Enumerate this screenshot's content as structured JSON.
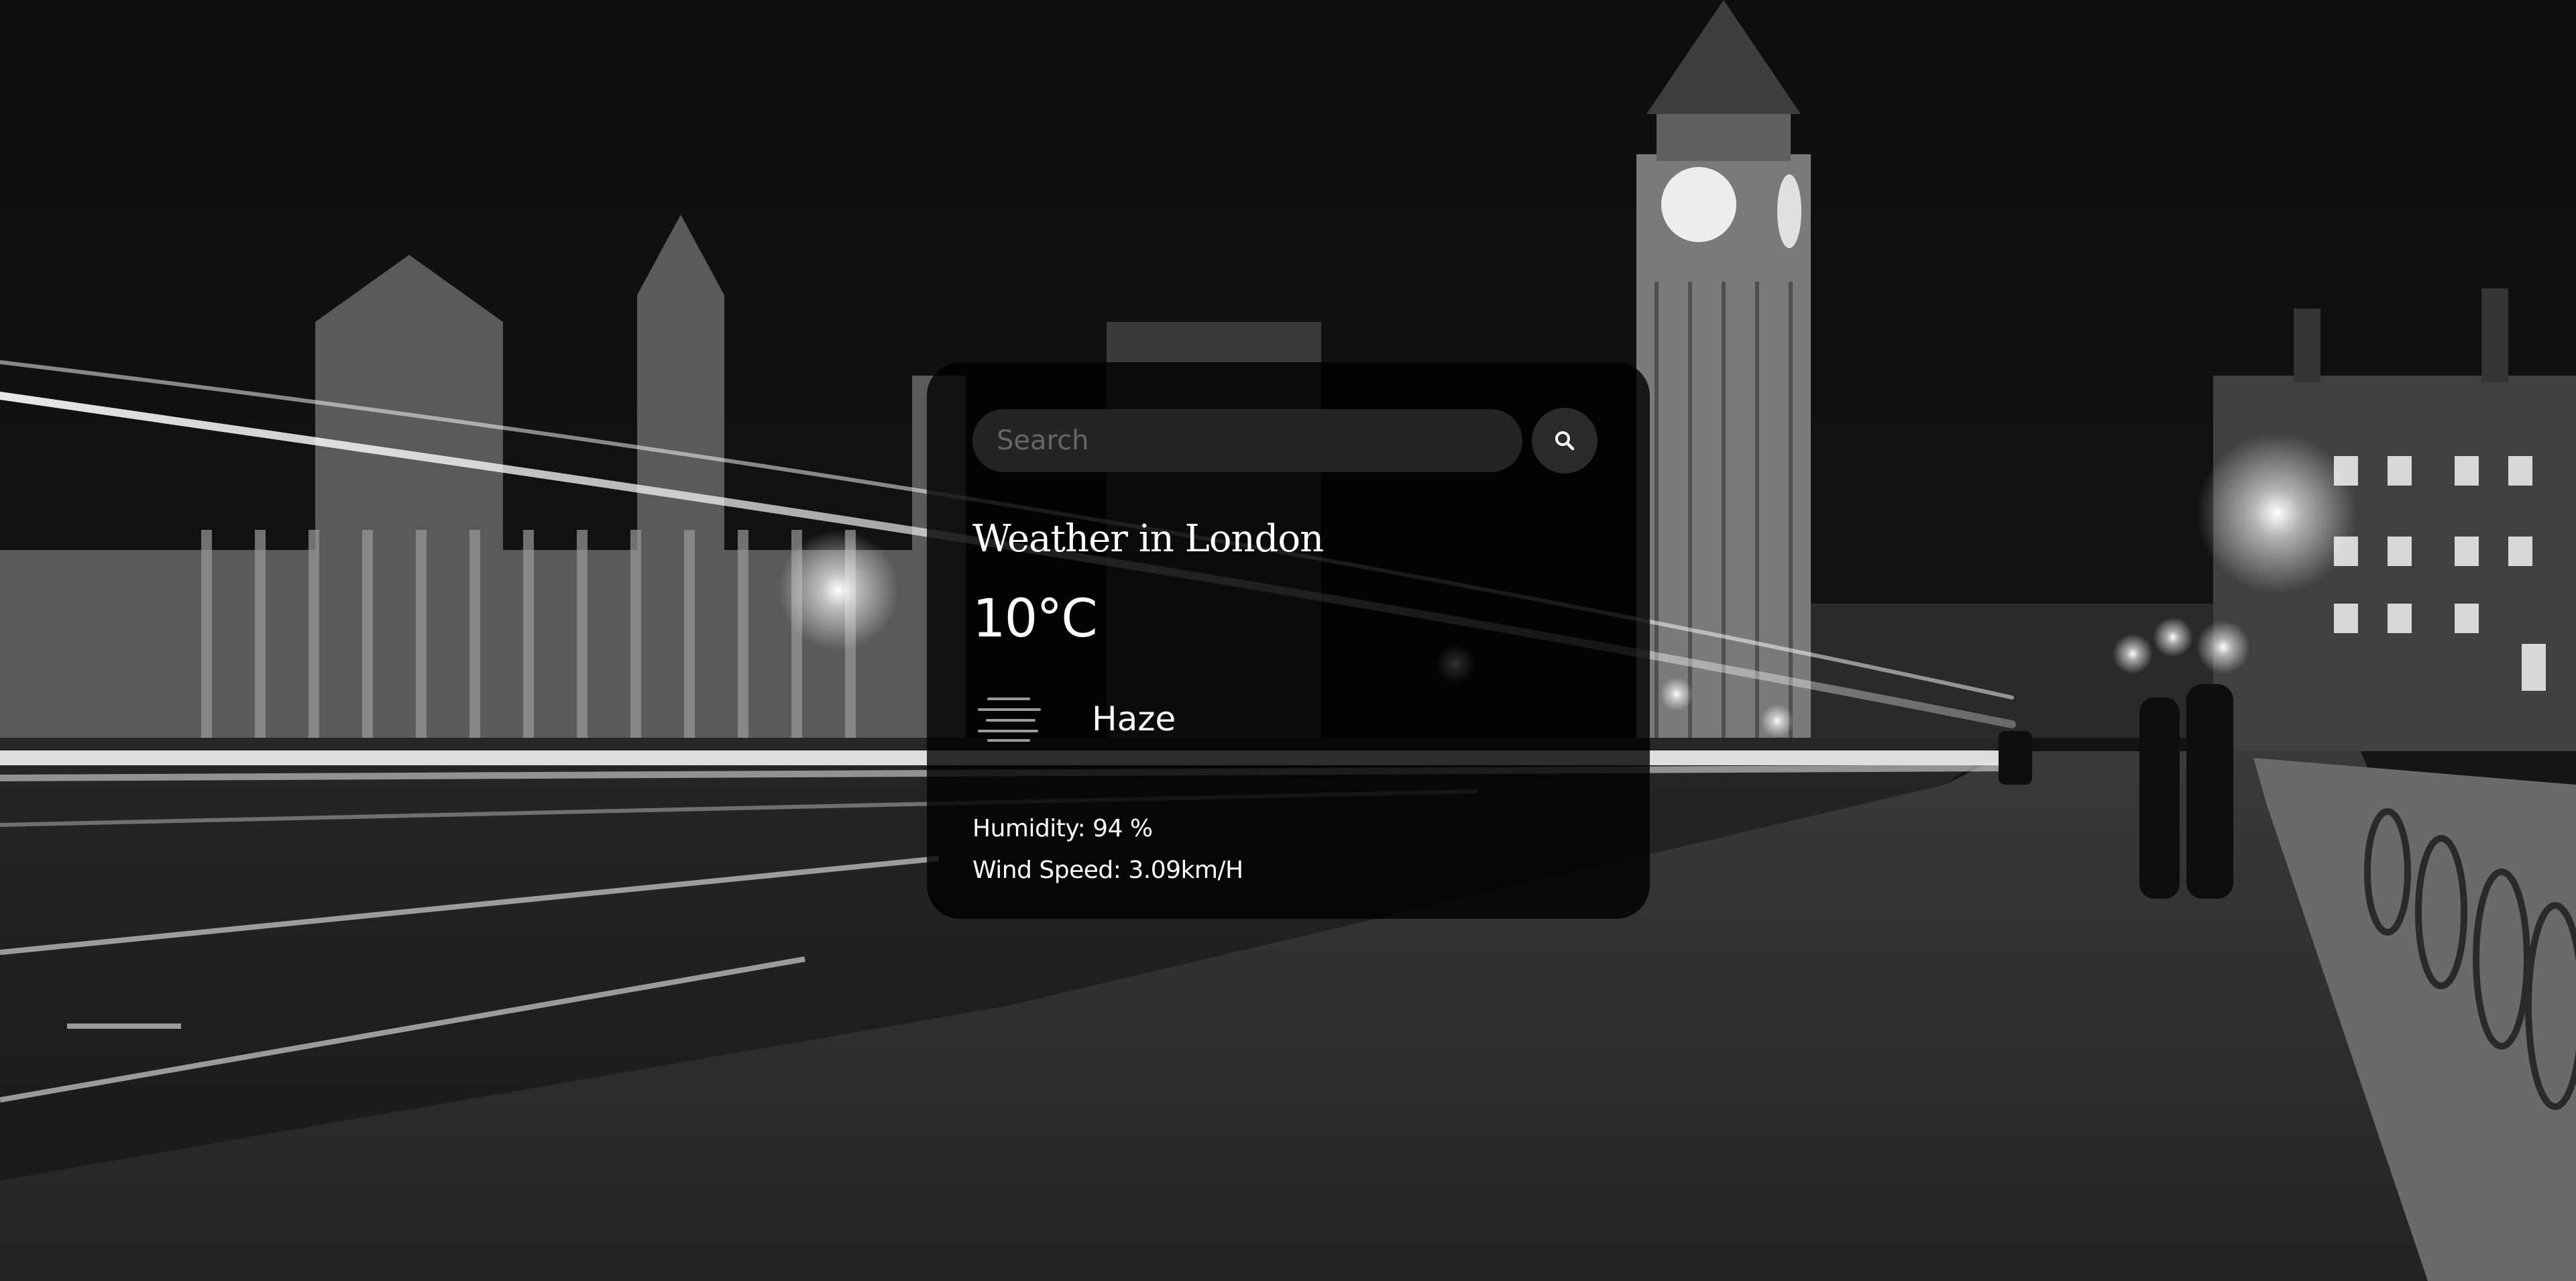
{
  "search": {
    "placeholder": "Search",
    "value": "",
    "button_icon": "search-icon"
  },
  "weather": {
    "title": "Weather in London",
    "temperature": "10°C",
    "description": "Haze",
    "icon": "haze-icon",
    "humidity": "Humidity: 94 %",
    "wind_speed": "Wind Speed: 3.09km/H"
  },
  "colors": {
    "card_background": "#000000",
    "text": "#ffffff",
    "input_background": "#242424",
    "button_background": "#2a2a2a"
  }
}
